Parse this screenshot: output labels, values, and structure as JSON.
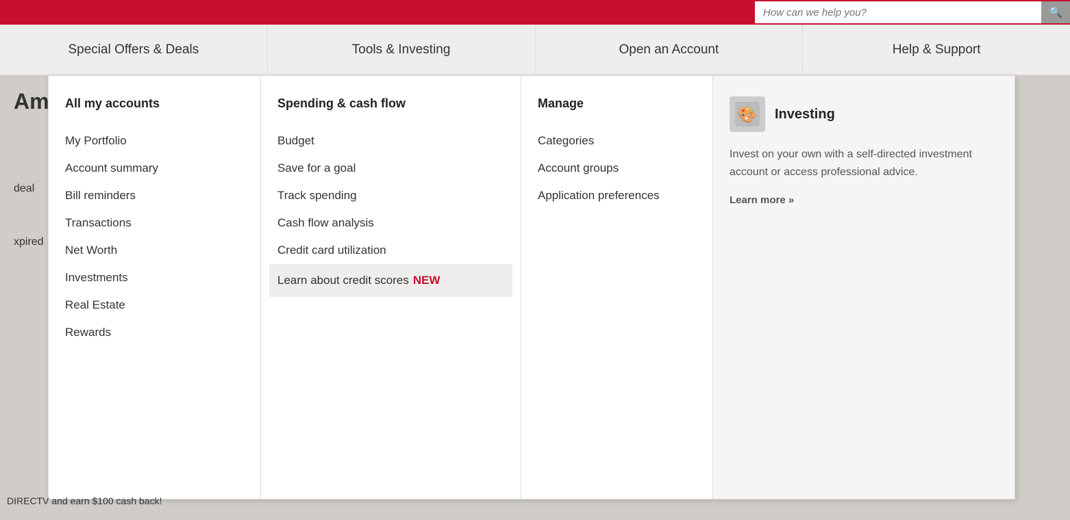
{
  "topBar": {
    "searchPlaceholder": "How can we help you?"
  },
  "nav": {
    "items": [
      {
        "id": "special-offers",
        "label": "Special Offers & Deals"
      },
      {
        "id": "tools-investing",
        "label": "Tools & Investing"
      },
      {
        "id": "open-account",
        "label": "Open an Account"
      },
      {
        "id": "help-support",
        "label": "Help & Support"
      }
    ]
  },
  "pageContent": {
    "titlePartial": "Ame",
    "dealLabel": "deal",
    "expiredLabel": "xpired",
    "bottomText": "DIRECTV and earn $100 cash back!"
  },
  "dropdown": {
    "col1": {
      "header": "All my accounts",
      "links": [
        "My Portfolio",
        "Account summary",
        "Bill reminders",
        "Transactions",
        "Net Worth",
        "Investments",
        "Real Estate",
        "Rewards"
      ]
    },
    "col2": {
      "header": "Spending & cash flow",
      "links": [
        "Budget",
        "Save for a goal",
        "Track spending",
        "Cash flow analysis",
        "Credit card utilization"
      ],
      "highlightedLink": {
        "text": "Learn about credit scores",
        "badge": "NEW"
      }
    },
    "col3": {
      "header": "Manage",
      "links": [
        "Categories",
        "Account groups",
        "Application preferences"
      ]
    },
    "col4": {
      "iconLabel": "investing-icon",
      "title": "Investing",
      "description": "Invest on your own with a self-directed investment account or access professional advice.",
      "learnMoreText": "Learn more »"
    }
  }
}
